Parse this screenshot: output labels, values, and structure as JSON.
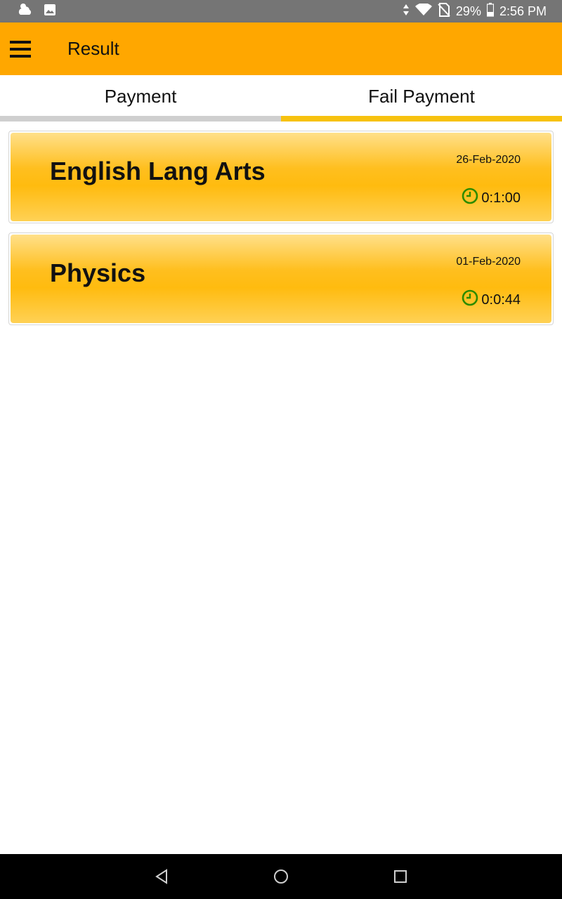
{
  "status_bar": {
    "battery": "29%",
    "time": "2:56 PM",
    "icons": [
      "weather-icon",
      "image-icon",
      "data-arrows-icon",
      "wifi-icon",
      "no-sim-icon",
      "battery-icon"
    ]
  },
  "app_bar": {
    "title": "Result",
    "menu_icon": "hamburger-menu-icon",
    "color": "#ffa700"
  },
  "tabs": [
    {
      "label": "Payment",
      "selected": false
    },
    {
      "label": "Fail Payment",
      "selected": true
    }
  ],
  "results": [
    {
      "subject": "English Lang Arts",
      "date": "26-Feb-2020",
      "duration": "0:1:00"
    },
    {
      "subject": "Physics",
      "date": "01-Feb-2020",
      "duration": "0:0:44"
    }
  ],
  "nav_bar": {
    "buttons": [
      "back-icon",
      "home-icon",
      "recents-icon"
    ]
  },
  "colors": {
    "accent": "#ffa700",
    "tab_indicator": "#f7c20f",
    "clock_icon": "#2e8b00"
  }
}
